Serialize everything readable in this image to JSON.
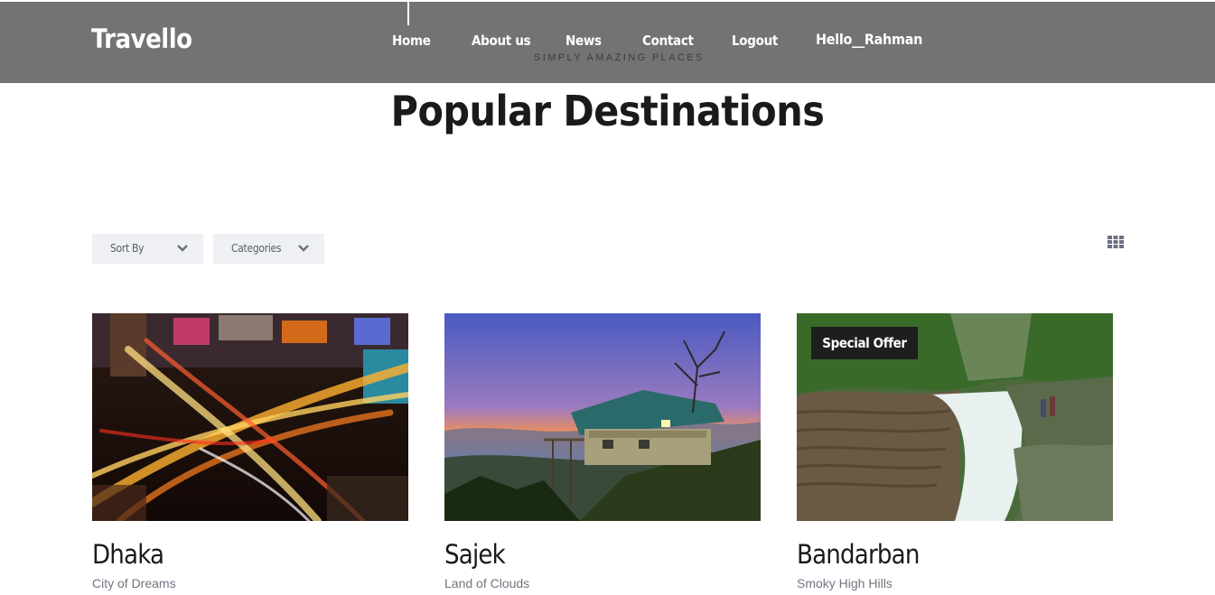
{
  "header": {
    "brand": "Travello",
    "tagline": "SIMPLY AMAZING PLACES",
    "nav": [
      {
        "label": "Home"
      },
      {
        "label": "About us"
      },
      {
        "label": "News"
      },
      {
        "label": "Contact"
      },
      {
        "label": "Logout"
      }
    ],
    "greeting": "Hello__Rahman"
  },
  "main": {
    "title": "Popular Destinations",
    "filters": {
      "sort_label": "Sort By",
      "categories_label": "Categories"
    },
    "view_toggle_icon": "grid-icon",
    "destinations": [
      {
        "name": "Dhaka",
        "subtitle": "City of Dreams",
        "badge": ""
      },
      {
        "name": "Sajek",
        "subtitle": "Land of Clouds",
        "badge": ""
      },
      {
        "name": "Bandarban",
        "subtitle": "Smoky High Hills",
        "badge": "Special Offer"
      }
    ]
  },
  "colors": {
    "header_bg": "#737373",
    "filter_bg": "#eef0f3",
    "badge_bg": "#1e1e1e",
    "icon": "#6a7080"
  }
}
